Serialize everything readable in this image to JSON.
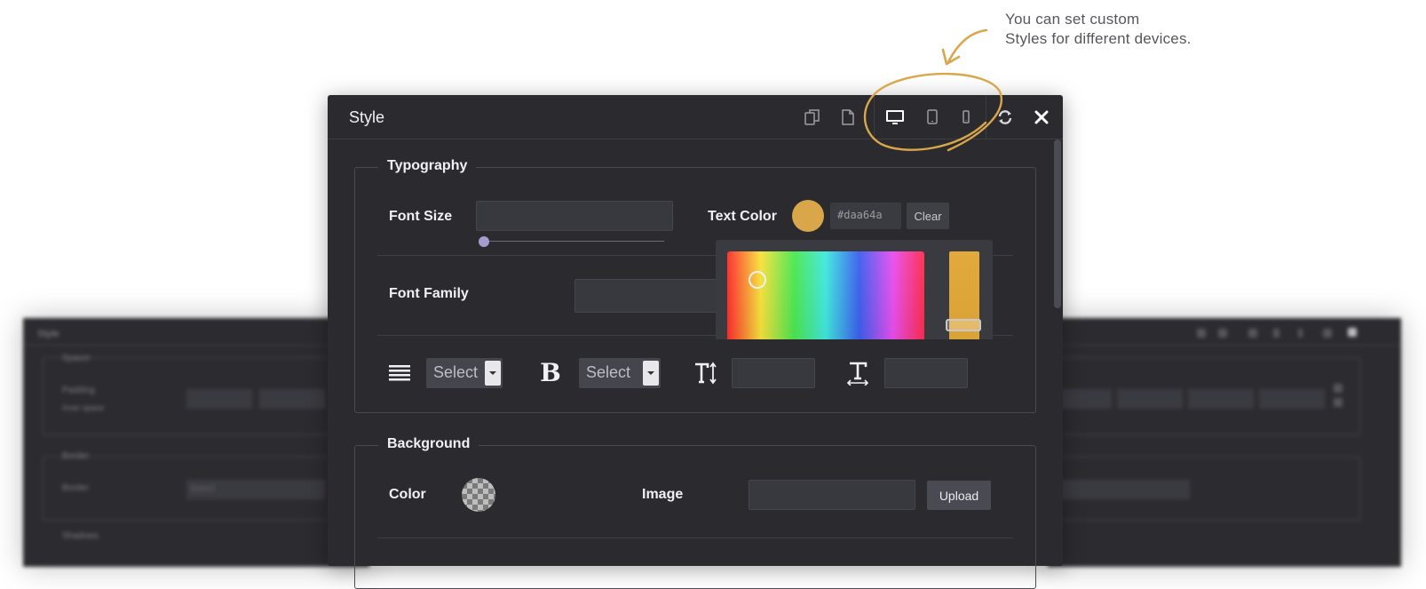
{
  "annotation": {
    "line1": "You can set custom",
    "line2": "Styles for different devices."
  },
  "dialog": {
    "title": "Style",
    "header_icons": [
      "copy-icon",
      "paste-icon",
      "desktop-icon",
      "tablet-icon",
      "mobile-icon",
      "refresh-icon",
      "close-icon"
    ],
    "accent_color": "#daa64a"
  },
  "typography": {
    "legend": "Typography",
    "font_size_label": "Font Size",
    "font_size_value": "",
    "text_color_label": "Text Color",
    "text_color_hex": "#daa64a",
    "clear_label": "Clear",
    "font_family_label": "Font Family",
    "font_family_value": "",
    "align_select": "Select",
    "weight_select": "Select",
    "line_height_value": "",
    "letter_spacing_value": ""
  },
  "background": {
    "legend": "Background",
    "color_label": "Color",
    "image_label": "Image",
    "image_value": "",
    "upload_label": "Upload"
  },
  "bg_panel_left": {
    "title": "Style",
    "section1": "Spacer",
    "padding_label": "Padding",
    "padding_sub": "Inner space",
    "section2": "Border",
    "border_label": "Border",
    "border_select": "Select",
    "section3": "Shadows"
  }
}
